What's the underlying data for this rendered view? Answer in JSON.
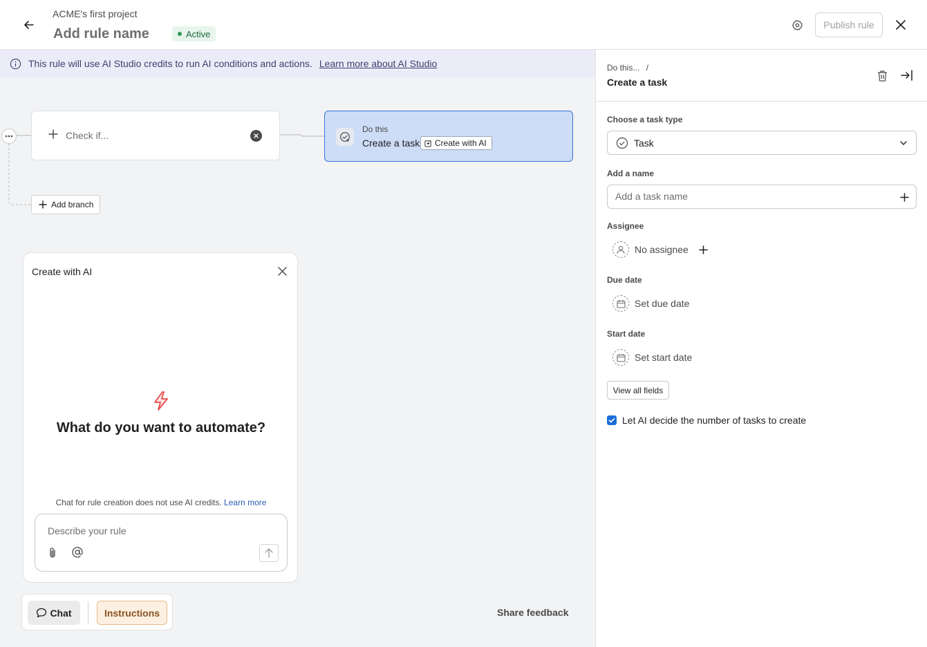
{
  "header": {
    "project_name": "ACME's first project",
    "rule_name": "Add rule name",
    "status": "Active",
    "publish_label": "Publish rule"
  },
  "banner": {
    "text": "This rule will use AI Studio credits to run AI conditions and actions.",
    "link": "Learn more about AI Studio"
  },
  "canvas": {
    "check_label": "Check if...",
    "do_label": "Do this",
    "do_title": "Create a task",
    "create_ai_chip": "Create with AI",
    "add_branch": "Add branch"
  },
  "ai_panel": {
    "title": "Create with AI",
    "question": "What do you want to automate?",
    "note": "Chat for rule creation does not use AI credits.",
    "note_link": "Learn more",
    "input_placeholder": "Describe your rule"
  },
  "bottom_bar": {
    "chat_label": "Chat",
    "instructions_label": "Instructions",
    "share_feedback": "Share feedback"
  },
  "right_panel": {
    "breadcrumb": "Do this...",
    "breadcrumb_sep": "/",
    "title": "Create a task",
    "task_type_label": "Choose a task type",
    "task_type_value": "Task",
    "name_label": "Add a name",
    "name_placeholder": "Add a task name",
    "assignee_label": "Assignee",
    "assignee_value": "No assignee",
    "due_date_label": "Due date",
    "due_date_value": "Set due date",
    "start_date_label": "Start date",
    "start_date_value": "Set start date",
    "view_all_label": "View all fields",
    "ai_decide_label": "Let AI decide the number of tasks to create",
    "ai_decide_checked": true
  },
  "colors": {
    "accent": "#3d73d3",
    "banner_bg": "#ececf8",
    "status_green": "#2f9c5a",
    "instructions_bg": "#fdf0e0",
    "bolt": "#e8494b"
  }
}
